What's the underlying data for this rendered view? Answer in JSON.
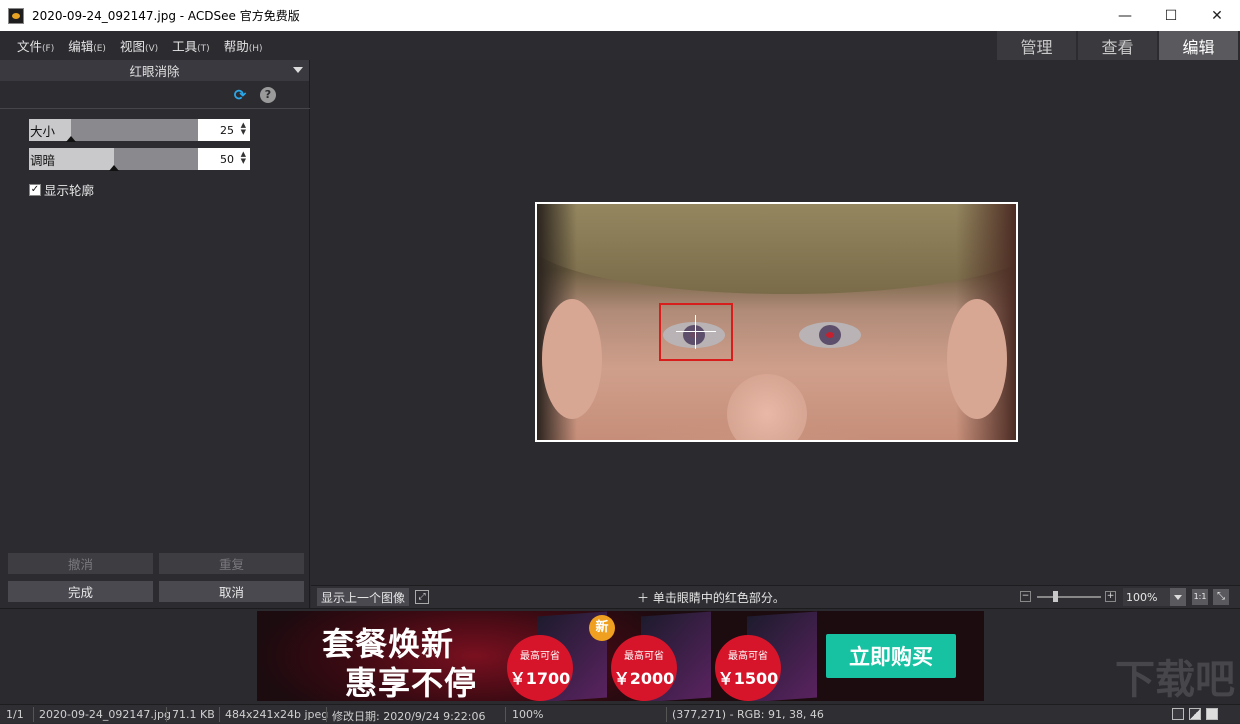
{
  "window": {
    "title": "2020-09-24_092147.jpg - ACDSee 官方免费版",
    "minimize": "—",
    "maximize": "☐",
    "close": "✕"
  },
  "menu": [
    {
      "label": "文件",
      "key": "(F)"
    },
    {
      "label": "编辑",
      "key": "(E)"
    },
    {
      "label": "视图",
      "key": "(V)"
    },
    {
      "label": "工具",
      "key": "(T)"
    },
    {
      "label": "帮助",
      "key": "(H)"
    }
  ],
  "modes": {
    "manage": "管理",
    "view": "查看",
    "edit": "编辑"
  },
  "panel": {
    "title": "红眼消除",
    "size": {
      "label": "大小",
      "value": "25",
      "level": 0.25
    },
    "darken": {
      "label": "调暗",
      "value": "50",
      "level": 0.5
    },
    "show_outline": {
      "label": "显示轮廓",
      "checked": true
    },
    "undo": "撤消",
    "redo": "重复",
    "done": "完成",
    "cancel": "取消"
  },
  "bottom": {
    "prev_image": "显示上一个图像",
    "hint": "单击眼睛中的红色部分。",
    "zoom": "100%",
    "one_to_one": "1:1"
  },
  "ad": {
    "line1": "套餐焕新",
    "line2": "惠享不停",
    "new_badge": "新",
    "offers": [
      {
        "title": "最高可省",
        "value": "￥1700"
      },
      {
        "title": "最高可省",
        "value": "￥2000"
      },
      {
        "title": "最高可省",
        "value": "￥1500"
      }
    ],
    "buy": "立即购买",
    "watermark": "下载吧"
  },
  "status": {
    "index": "1/1",
    "filename": "2020-09-24_092147.jpg",
    "filesize": "71.1 KB",
    "dims": "484x241x24b jpeg",
    "modified": "修改日期: 2020/9/24 9:22:06",
    "zoom": "100%",
    "pixel": "(377,271) - RGB: 91, 38, 46"
  },
  "colors": {
    "accent_red": "#d81d1d",
    "buy_teal": "#17c2a3",
    "offer_red": "#d6152a"
  }
}
